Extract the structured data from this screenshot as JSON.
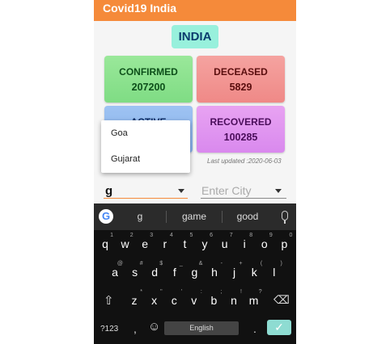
{
  "app": {
    "title": "Covid19 India"
  },
  "country": "INDIA",
  "stats": {
    "confirmed": {
      "label": "CONFIRMED",
      "value": "207200"
    },
    "deceased": {
      "label": "DECEASED",
      "value": "5829"
    },
    "active": {
      "label": "ACTIVE",
      "value": ""
    },
    "recovered": {
      "label": "RECOVERED",
      "value": "100285"
    }
  },
  "last_updated": "Last updated :2020-06-03",
  "dropdown": {
    "items": [
      "Goa",
      "Gujarat"
    ]
  },
  "state_input": {
    "value": "g"
  },
  "city_input": {
    "placeholder": "Enter City"
  },
  "keyboard": {
    "suggestions": [
      "g",
      "game",
      "good"
    ],
    "row1": [
      "q",
      "w",
      "e",
      "r",
      "t",
      "y",
      "u",
      "i",
      "o",
      "p"
    ],
    "row1_sup": [
      "1",
      "2",
      "3",
      "4",
      "5",
      "6",
      "7",
      "8",
      "9",
      "0"
    ],
    "row2": [
      "a",
      "s",
      "d",
      "f",
      "g",
      "h",
      "j",
      "k",
      "l"
    ],
    "row2_sup": [
      "@",
      "#",
      "$",
      "_",
      "&",
      "-",
      "+",
      "(",
      ")"
    ],
    "row3": [
      "z",
      "x",
      "c",
      "v",
      "b",
      "n",
      "m"
    ],
    "row3_sup": [
      "*",
      "\"",
      "'",
      ":",
      ";",
      "!",
      "?"
    ],
    "symbols_label": "?123",
    "comma": ",",
    "period": ".",
    "space_label": "English"
  },
  "colors": {
    "appbar": "#f58a3a",
    "enter_key": "#8edcd2"
  }
}
